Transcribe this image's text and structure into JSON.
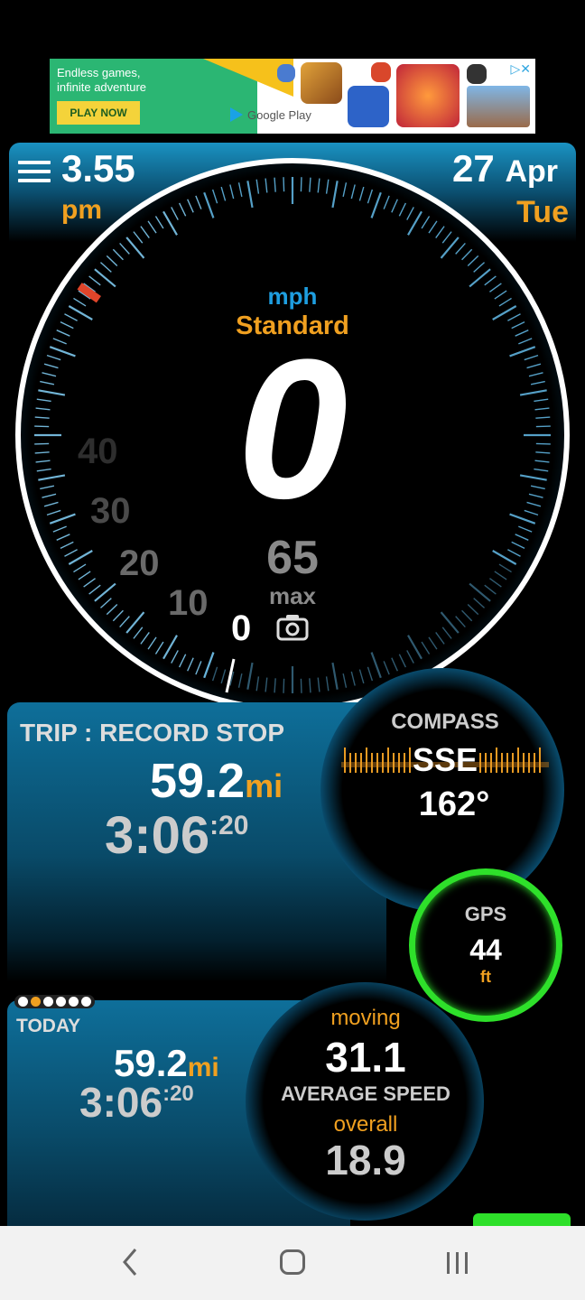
{
  "ad": {
    "headline": "Endless games, infinite adventure",
    "cta": "PLAY NOW",
    "store": "Google Play"
  },
  "header": {
    "time": "3.55",
    "ampm": "pm",
    "day": "27",
    "month": "Apr",
    "weekday": "Tue"
  },
  "speedometer": {
    "unit": "mph",
    "mode": "Standard",
    "speed": "0",
    "max": "65",
    "max_label": "max",
    "scale": [
      "0",
      "10",
      "20",
      "30",
      "40"
    ]
  },
  "trip": {
    "label": "TRIP : RECORD STOP",
    "distance": "59.2",
    "distance_unit": "mi",
    "time_main": "3:06",
    "time_sec": ":20"
  },
  "compass": {
    "label": "COMPASS",
    "heading": "SSE",
    "degrees": "162°"
  },
  "gps": {
    "label": "GPS",
    "value": "44",
    "unit": "ft"
  },
  "today": {
    "label": "TODAY",
    "distance": "59.2",
    "distance_unit": "mi",
    "time_main": "3:06",
    "time_sec": ":20",
    "page_dots": 6,
    "active_dot": 1
  },
  "average": {
    "moving_label": "moving",
    "moving_value": "31.1",
    "label": "AVERAGE SPEED",
    "overall_label": "overall",
    "overall_value": "18.9"
  },
  "colors": {
    "accent_orange": "#f0a020",
    "accent_blue": "#1e9ee0",
    "gps_green": "#2ee02a"
  }
}
